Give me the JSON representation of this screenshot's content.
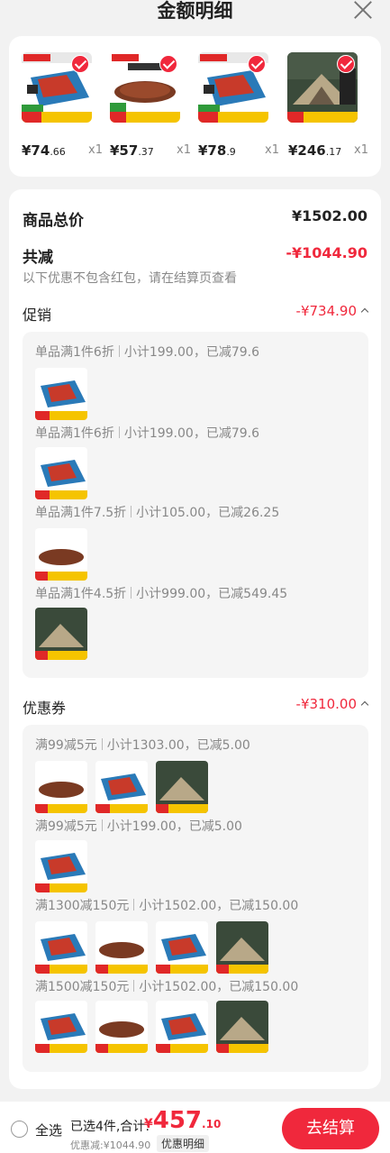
{
  "header": {
    "title": "金额明细"
  },
  "products": [
    {
      "name": "mat-product",
      "price_int": "¥74",
      "price_dec": ".66",
      "qty": "x1",
      "theme": "mat"
    },
    {
      "name": "plate-product",
      "price_int": "¥57",
      "price_dec": ".37",
      "qty": "x1",
      "theme": "plate"
    },
    {
      "name": "mat-product-2",
      "price_int": "¥78",
      "price_dec": ".9",
      "qty": "x1",
      "theme": "mat"
    },
    {
      "name": "tent-product",
      "price_int": "¥246",
      "price_dec": ".17",
      "qty": "x1",
      "theme": "tent"
    }
  ],
  "summary": {
    "total_label": "商品总价",
    "total_value": "¥1502.00",
    "reduce_label": "共减",
    "reduce_value": "-¥1044.90",
    "note": "以下优惠不包含红包，请在结算页查看"
  },
  "promo": {
    "label": "促销",
    "value": "-¥734.90",
    "rules": [
      {
        "title": "单品满1件6折",
        "detail": "小计199.00，已减79.6"
      },
      {
        "title": "单品满1件6折",
        "detail": "小计199.00，已减79.6"
      },
      {
        "title": "单品满1件7.5折",
        "detail": "小计105.00，已减26.25"
      },
      {
        "title": "单品满1件4.5折",
        "detail": "小计999.00，已减549.45"
      }
    ]
  },
  "coupon": {
    "label": "优惠券",
    "value": "-¥310.00",
    "rules": [
      {
        "title": "满99减5元",
        "detail": "小计1303.00，已减5.00"
      },
      {
        "title": "满99减5元",
        "detail": "小计199.00，已减5.00"
      },
      {
        "title": "满1300减150元",
        "detail": "小计1502.00，已减150.00"
      },
      {
        "title": "满1500减150元",
        "detail": "小计1502.00，已减150.00"
      }
    ]
  },
  "bottom": {
    "select_all": "全选",
    "selected_info": "已选4件,合计:",
    "total_yen": "¥",
    "total_int": "457",
    "total_dec": ".10",
    "discount": "优惠减:¥1044.90",
    "detail_button": "优惠明细",
    "pay_button": "去结算"
  },
  "colors": {
    "accent": "#f0283c"
  }
}
